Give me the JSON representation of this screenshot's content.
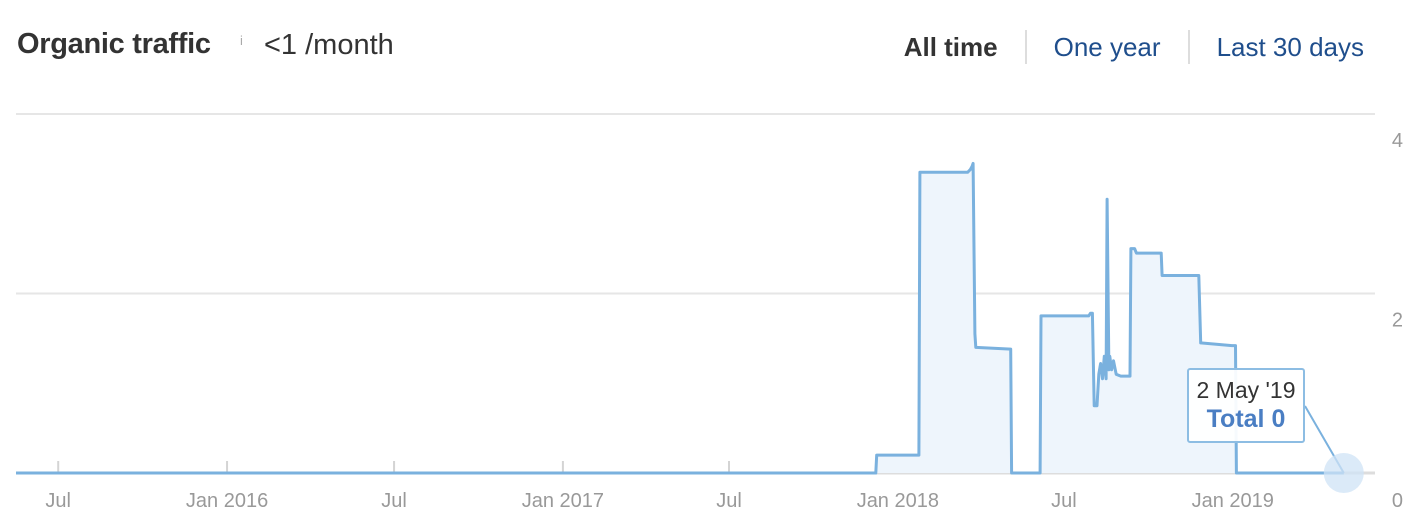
{
  "header": {
    "title": "Organic traffic",
    "info_icon": "info-icon",
    "info_glyph": "i",
    "metric_value": "<1 /month"
  },
  "range_tabs": [
    {
      "label": "All time",
      "active": true
    },
    {
      "label": "One year",
      "active": false
    },
    {
      "label": "Last 30 days",
      "active": false
    }
  ],
  "colors": {
    "line": "#7ab1de",
    "fill": "#eef5fc",
    "grid": "#e6e6e6",
    "axis_text": "#999999",
    "active_tab": "#333333",
    "tab_link": "#1f4e8c",
    "tooltip_total": "#4a7ec3",
    "marker": "#cfe3f5"
  },
  "tooltip": {
    "date": "2 May '19",
    "total": "Total 0"
  },
  "chart_data": {
    "type": "area",
    "title": "Organic traffic",
    "xlabel": "",
    "ylabel": "",
    "xlim": [
      "2015-05-16",
      "2019-06-05"
    ],
    "ylim": [
      0,
      4
    ],
    "y_ticks": [
      0,
      2,
      4
    ],
    "y_tick_labels": [
      "0",
      "2",
      "4"
    ],
    "y_axis_position": "right",
    "x_ticks": [
      "2015-07-01",
      "2016-01-01",
      "2016-07-01",
      "2017-01-01",
      "2017-07-01",
      "2018-01-01",
      "2018-07-01",
      "2019-01-01"
    ],
    "x_tick_labels": [
      "Jul",
      "Jan 2016",
      "Jul",
      "Jan 2017",
      "Jul",
      "Jan 2018",
      "Jul",
      "Jan 2019"
    ],
    "grid": true,
    "legend": "none",
    "step": true,
    "series": [
      {
        "name": "Organic traffic",
        "points": [
          [
            "2015-05-16",
            0
          ],
          [
            "2017-12-08",
            0
          ],
          [
            "2017-12-09",
            0.2
          ],
          [
            "2017-12-31",
            0.2
          ],
          [
            "2018-01-24",
            0.2
          ],
          [
            "2018-01-25",
            3.35
          ],
          [
            "2018-03-18",
            3.35
          ],
          [
            "2018-03-21",
            3.38
          ],
          [
            "2018-03-23",
            3.42
          ],
          [
            "2018-03-24",
            3.45
          ],
          [
            "2018-03-26",
            1.55
          ],
          [
            "2018-03-27",
            1.4
          ],
          [
            "2018-05-04",
            1.38
          ],
          [
            "2018-05-05",
            0
          ],
          [
            "2018-06-05",
            0
          ],
          [
            "2018-06-06",
            1.75
          ],
          [
            "2018-07-28",
            1.75
          ],
          [
            "2018-07-30",
            1.78
          ],
          [
            "2018-08-01",
            1.78
          ],
          [
            "2018-08-03",
            0.75
          ],
          [
            "2018-08-06",
            0.75
          ],
          [
            "2018-08-08",
            1.1
          ],
          [
            "2018-08-10",
            1.22
          ],
          [
            "2018-08-12",
            1.05
          ],
          [
            "2018-08-14",
            1.3
          ],
          [
            "2018-08-16",
            1.05
          ],
          [
            "2018-08-17",
            3.05
          ],
          [
            "2018-08-19",
            1.15
          ],
          [
            "2018-08-20",
            1.3
          ],
          [
            "2018-08-22",
            1.15
          ],
          [
            "2018-08-24",
            1.25
          ],
          [
            "2018-08-27",
            1.1
          ],
          [
            "2018-09-01",
            1.08
          ],
          [
            "2018-09-11",
            1.08
          ],
          [
            "2018-09-12",
            2.5
          ],
          [
            "2018-09-16",
            2.5
          ],
          [
            "2018-09-18",
            2.45
          ],
          [
            "2018-10-15",
            2.45
          ],
          [
            "2018-10-16",
            2.2
          ],
          [
            "2018-11-25",
            2.2
          ],
          [
            "2018-11-27",
            1.45
          ],
          [
            "2018-12-31",
            1.42
          ],
          [
            "2019-01-04",
            1.42
          ],
          [
            "2019-01-05",
            0
          ],
          [
            "2019-05-02",
            0
          ]
        ]
      }
    ],
    "highlight_point": {
      "date": "2019-05-02",
      "value": 0,
      "label": "2 May '19",
      "total": "Total 0"
    }
  }
}
